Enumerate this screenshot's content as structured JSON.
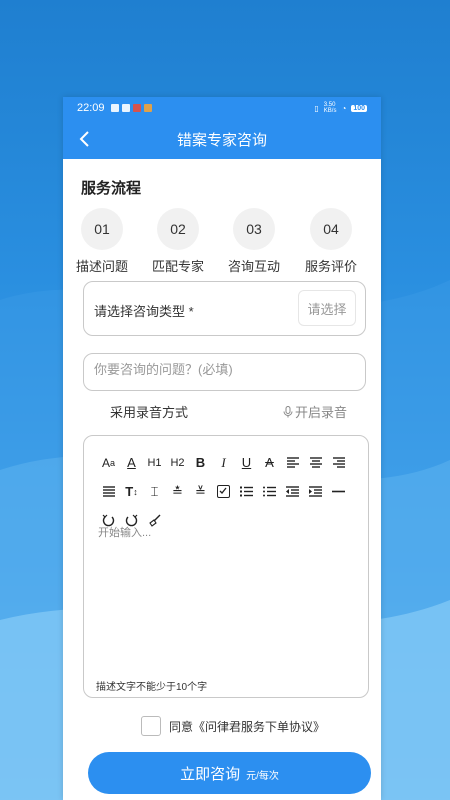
{
  "status_bar": {
    "time": "22:09",
    "network_speed": "3.50\nKB/s",
    "battery": "100"
  },
  "header": {
    "title": "错案专家咨询"
  },
  "process": {
    "title": "服务流程",
    "steps": [
      {
        "num": "01",
        "label": "描述问题"
      },
      {
        "num": "02",
        "label": "匹配专家"
      },
      {
        "num": "03",
        "label": "咨询互动"
      },
      {
        "num": "04",
        "label": "服务评价"
      }
    ]
  },
  "consult_type": {
    "label": "请选择咨询类型 *",
    "button": "请选择"
  },
  "question": {
    "placeholder": "你要咨询的问题？(必填)"
  },
  "record": {
    "mode_label": "采用录音方式",
    "start_label": "开启录音"
  },
  "editor": {
    "placeholder": "开始输入...",
    "hint": "描述文字不能少于10个字"
  },
  "agreement": {
    "text": "同意《问律君服务下单协议》"
  },
  "submit": {
    "label": "立即咨询",
    "unit": "元/每次"
  },
  "colors": {
    "primary": "#2c8ff0",
    "background_top": "#1f7fd0"
  }
}
